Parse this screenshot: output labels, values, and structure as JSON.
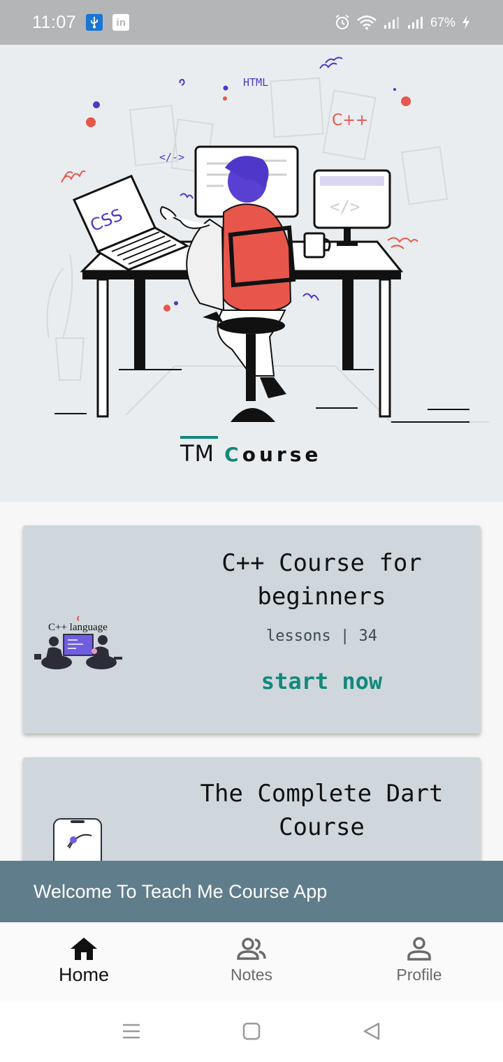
{
  "status_bar": {
    "time": "11:07",
    "left_icons": [
      "usb-icon",
      "linkedin-icon"
    ],
    "right_icons": [
      "alarm-icon",
      "wifi-icon",
      "signal-icon",
      "signal-icon",
      "battery-charging-icon"
    ],
    "battery": "67%"
  },
  "hero": {
    "illustration": [
      "HTML",
      "C++",
      "</->",
      "CSS"
    ],
    "brand_tm": "TM",
    "brand_course_first": "C",
    "brand_course_rest": "ourse"
  },
  "courses": [
    {
      "thumb_label": "C++ language",
      "title_line1": "C++ Course for",
      "title_line2": "beginners",
      "lessons": "lessons | 34",
      "action": "start now"
    },
    {
      "title_line1": "The Complete Dart",
      "title_line2": "Course"
    }
  ],
  "snackbar": {
    "message": "Welcome To Teach Me Course App"
  },
  "bottom_nav": {
    "items": [
      {
        "label": "Home",
        "icon": "home-icon",
        "active": true
      },
      {
        "label": "Notes",
        "icon": "people-icon",
        "active": false
      },
      {
        "label": "Profile",
        "icon": "person-icon",
        "active": false
      }
    ]
  },
  "system_nav": [
    "menu-icon",
    "home-square-icon",
    "back-icon"
  ],
  "colors": {
    "accent": "#13897d",
    "card": "#cfd7dc",
    "snackbar": "#607d8b",
    "hero_bg": "#eaedf0"
  }
}
